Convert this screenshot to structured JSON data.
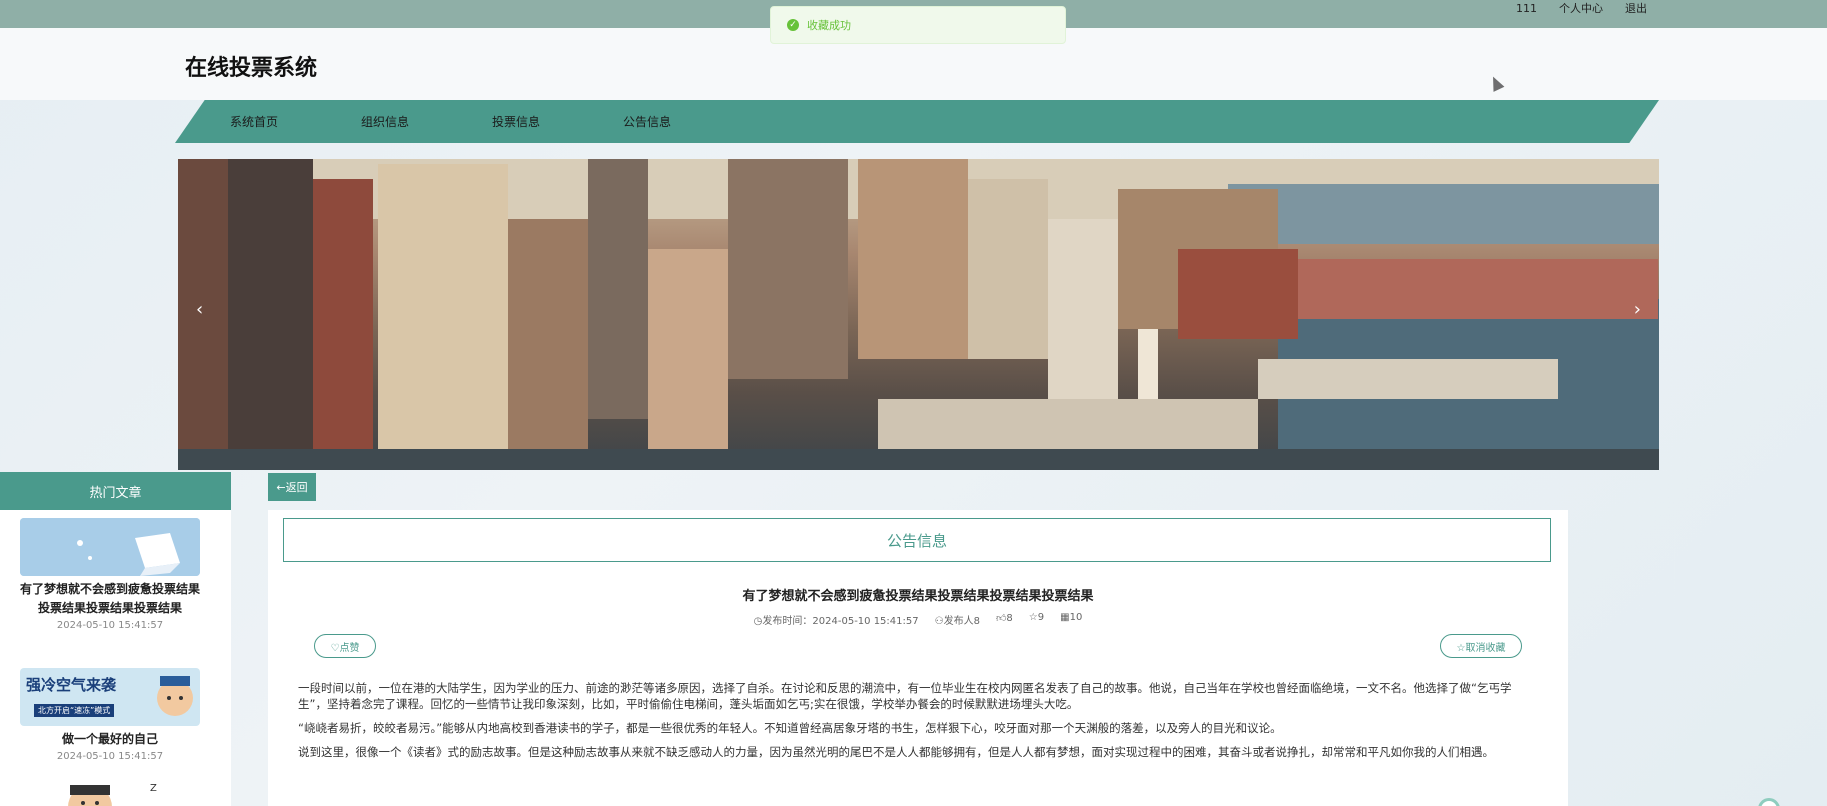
{
  "topbar": {
    "username": "111",
    "profile": "个人中心",
    "logout": "退出"
  },
  "toast": {
    "message": "收藏成功"
  },
  "header": {
    "title": "在线投票系统"
  },
  "nav": [
    "系统首页",
    "组织信息",
    "投票信息",
    "公告信息"
  ],
  "banner": {
    "prev": "‹",
    "next": "›"
  },
  "sidebar": {
    "heading": "热门文章",
    "items": [
      {
        "title": "有了梦想就不会感到疲惫投票结果投票结果投票结果投票结果",
        "date": "2024-05-10 15:41:57"
      },
      {
        "title": "做一个最好的自己",
        "date": "2024-05-10 15:41:57",
        "thumb_text": "强冷空气来袭",
        "thumb_sub": "北方开启“速冻”模式"
      }
    ]
  },
  "back": "←返回",
  "section": {
    "title": "公告信息"
  },
  "article": {
    "title": "有了梦想就不会感到疲惫投票结果投票结果投票结果投票结果",
    "publish_time": "发布时间：2024-05-10 15:41:57",
    "author": "发布人8",
    "likes": "8",
    "favorites": "9",
    "views": "10",
    "like_btn": "♡点赞",
    "unfav_btn": "☆取消收藏",
    "paragraphs": [
      "一段时间以前，一位在港的大陆学生，因为学业的压力、前途的渺茫等诸多原因，选择了自杀。在讨论和反思的潮流中，有一位毕业生在校内网匿名发表了自己的故事。他说，自己当年在学校也曾经面临绝境，一文不名。他选择了做“乞丐学生”，坚持着念完了课程。回忆的一些情节让我印象深刻，比如，平时偷偷住电梯间，蓬头垢面如乞丐;实在很饿，学校举办餐会的时候默默进场埋头大吃。",
      "“峣峣者易折，皎皎者易污。”能够从内地高校到香港读书的学子，都是一些很优秀的年轻人。不知道曾经高居象牙塔的书生，怎样狠下心，咬牙面对那一个天渊般的落差，以及旁人的目光和议论。",
      "说到这里，很像一个《读者》式的励志故事。但是这种励志故事从来就不缺乏感动人的力量，因为虽然光明的尾巴不是人人都能够拥有，但是人人都有梦想，面对实现过程中的困难，其奋斗或者说挣扎，却常常和平凡如你我的人们相遇。"
    ]
  }
}
